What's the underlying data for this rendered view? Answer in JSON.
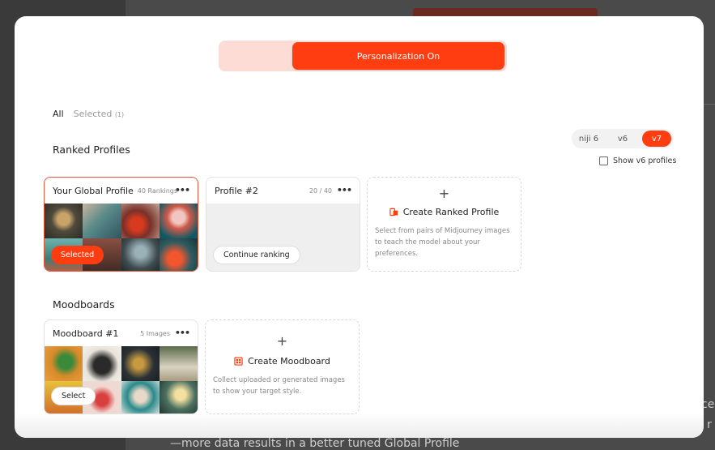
{
  "background": {
    "bottom_text": "—more data results in a better tuned Global Profile",
    "right_text_1": "ce",
    "right_text_2": "r"
  },
  "toggle": {
    "label": "Personalization On"
  },
  "filters": {
    "all": "All",
    "selected": "Selected",
    "selected_count": "(1)"
  },
  "versions": [
    {
      "label": "niji 6",
      "active": false
    },
    {
      "label": "v6",
      "active": false
    },
    {
      "label": "v7",
      "active": true
    }
  ],
  "show_v6_label": "Show v6 profiles",
  "ranked": {
    "title": "Ranked Profiles",
    "cards": [
      {
        "title": "Your Global Profile",
        "count": "40 Rankings",
        "menu": "•••",
        "button": "Selected"
      },
      {
        "title": "Profile #2",
        "count": "20 / 40",
        "menu": "•••",
        "button": "Continue ranking"
      }
    ],
    "create": {
      "plus": "+",
      "title": "Create Ranked Profile",
      "desc": "Select from pairs of Midjourney images to teach the model about your preferences."
    }
  },
  "moodboards": {
    "title": "Moodboards",
    "cards": [
      {
        "title": "Moodboard #1",
        "count": "5 Images",
        "menu": "•••",
        "button": "Select"
      }
    ],
    "create": {
      "plus": "+",
      "title": "Create Moodboard",
      "desc": "Collect uploaded or generated images to show your target style."
    }
  },
  "colors": {
    "accent": "#ff3d10",
    "accent_light": "#fcdcd4"
  }
}
